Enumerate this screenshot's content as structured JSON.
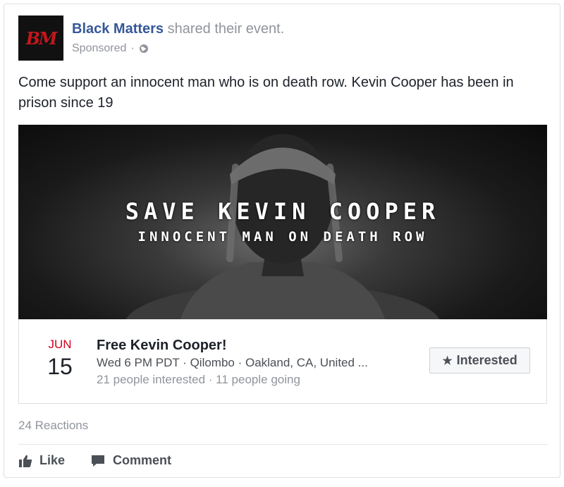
{
  "post": {
    "avatar_text": "BM",
    "page_name": "Black Matters",
    "action_text": " shared their event.",
    "sponsored_label": "Sponsored",
    "separator": " · ",
    "body_text": "Come support an innocent man who is on death row. Kevin Cooper has been in prison since 19"
  },
  "banner": {
    "title": "SAVE KEVIN COOPER",
    "subtitle": "INNOCENT MAN ON DEATH ROW"
  },
  "event": {
    "month": "JUN",
    "day": "15",
    "title": "Free Kevin Cooper!",
    "when_where": "Wed 6 PM PDT · Qilombo · Oakland, CA, United ...",
    "stats": "21 people interested · 11 people going",
    "interested_label": "Interested",
    "interested_icon": "star-icon"
  },
  "footer": {
    "reactions": "24 Reactions",
    "like_label": "Like",
    "comment_label": "Comment"
  },
  "colors": {
    "link": "#365899",
    "month": "#d0021b",
    "muted": "#90949c",
    "avatar_letters": "#c2171d"
  }
}
